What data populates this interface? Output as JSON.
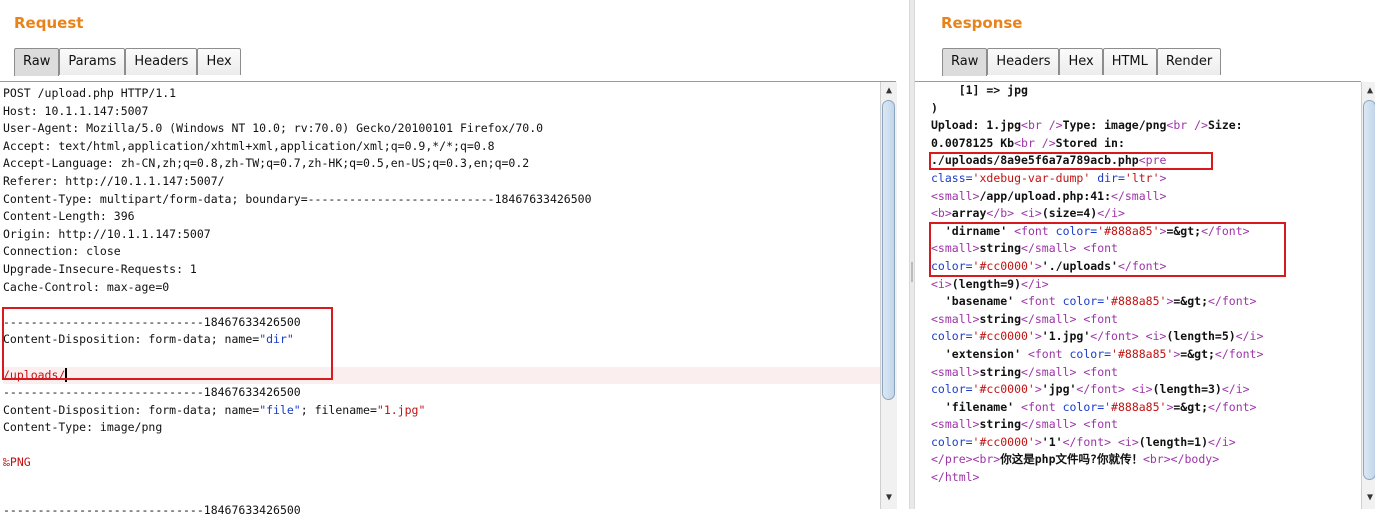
{
  "request": {
    "title": "Request",
    "tabs": [
      "Raw",
      "Params",
      "Headers",
      "Hex"
    ],
    "active_tab": "Raw",
    "lines": [
      "POST /upload.php HTTP/1.1",
      "Host: 10.1.1.147:5007",
      "User-Agent: Mozilla/5.0 (Windows NT 10.0; rv:70.0) Gecko/20100101 Firefox/70.0",
      "Accept: text/html,application/xhtml+xml,application/xml;q=0.9,*/*;q=0.8",
      "Accept-Language: zh-CN,zh;q=0.8,zh-TW;q=0.7,zh-HK;q=0.5,en-US;q=0.3,en;q=0.2",
      "Referer: http://10.1.1.147:5007/",
      "Content-Type: multipart/form-data; boundary=---------------------------18467633426500",
      "Content-Length: 396",
      "Origin: http://10.1.1.147:5007",
      "Connection: close",
      "Upgrade-Insecure-Requests: 1",
      "Cache-Control: max-age=0",
      "",
      "-----------------------------18467633426500",
      "Content-Disposition: form-data; name=\"dir\"",
      "",
      "/uploads/",
      "-----------------------------18467633426500",
      "Content-Disposition: form-data; name=\"file\"; filename=\"1.jpg\"",
      "Content-Type: image/png",
      "",
      "‰PNG",
      "",
      "",
      "",
      "-----------------------------18467633426500"
    ],
    "dir_value": "/uploads/",
    "png_marker": "‰PNG"
  },
  "response": {
    "title": "Response",
    "tabs": [
      "Raw",
      "Headers",
      "Hex",
      "HTML",
      "Render"
    ],
    "active_tab": "Raw",
    "lines": [
      "    [1] => jpg",
      ")",
      "Upload: 1.jpg<br />Type: image/png<br />Size:",
      "0.0078125 Kb<br />Stored in:",
      "./uploads/8a9e5f6a7a789acb.php<pre",
      "class='xdebug-var-dump' dir='ltr'>",
      "<small>/app/upload.php:41:</small>",
      "<b>array</b> <i>(size=4)</i>",
      "  'dirname' <font color='#888a85'>=&gt;</font>",
      "<small>string</small> <font",
      "color='#cc0000'>'./uploads'</font>",
      "<i>(length=9)</i>",
      "  'basename' <font color='#888a85'>=&gt;</font>",
      "<small>string</small> <font",
      "color='#cc0000'>'1.jpg'</font> <i>(length=5)</i>",
      "  'extension' <font color='#888a85'>=&gt;</font>",
      "<small>string</small> <font",
      "color='#cc0000'>'jpg'</font> <i>(length=3)</i>",
      "  'filename' <font color='#888a85'>=&gt;</font>",
      "<small>string</small> <font",
      "color='#cc0000'>'1'</font> <i>(length=1)</i>",
      "</pre><br>你这是php文件吗?你就传！<br></body>",
      "</html>"
    ]
  },
  "colors": {
    "title": "#e8831c",
    "highlight_box": "#d8191d",
    "string": "#1a3cc8",
    "tag": "#9d34a8",
    "value": "#c21212"
  }
}
